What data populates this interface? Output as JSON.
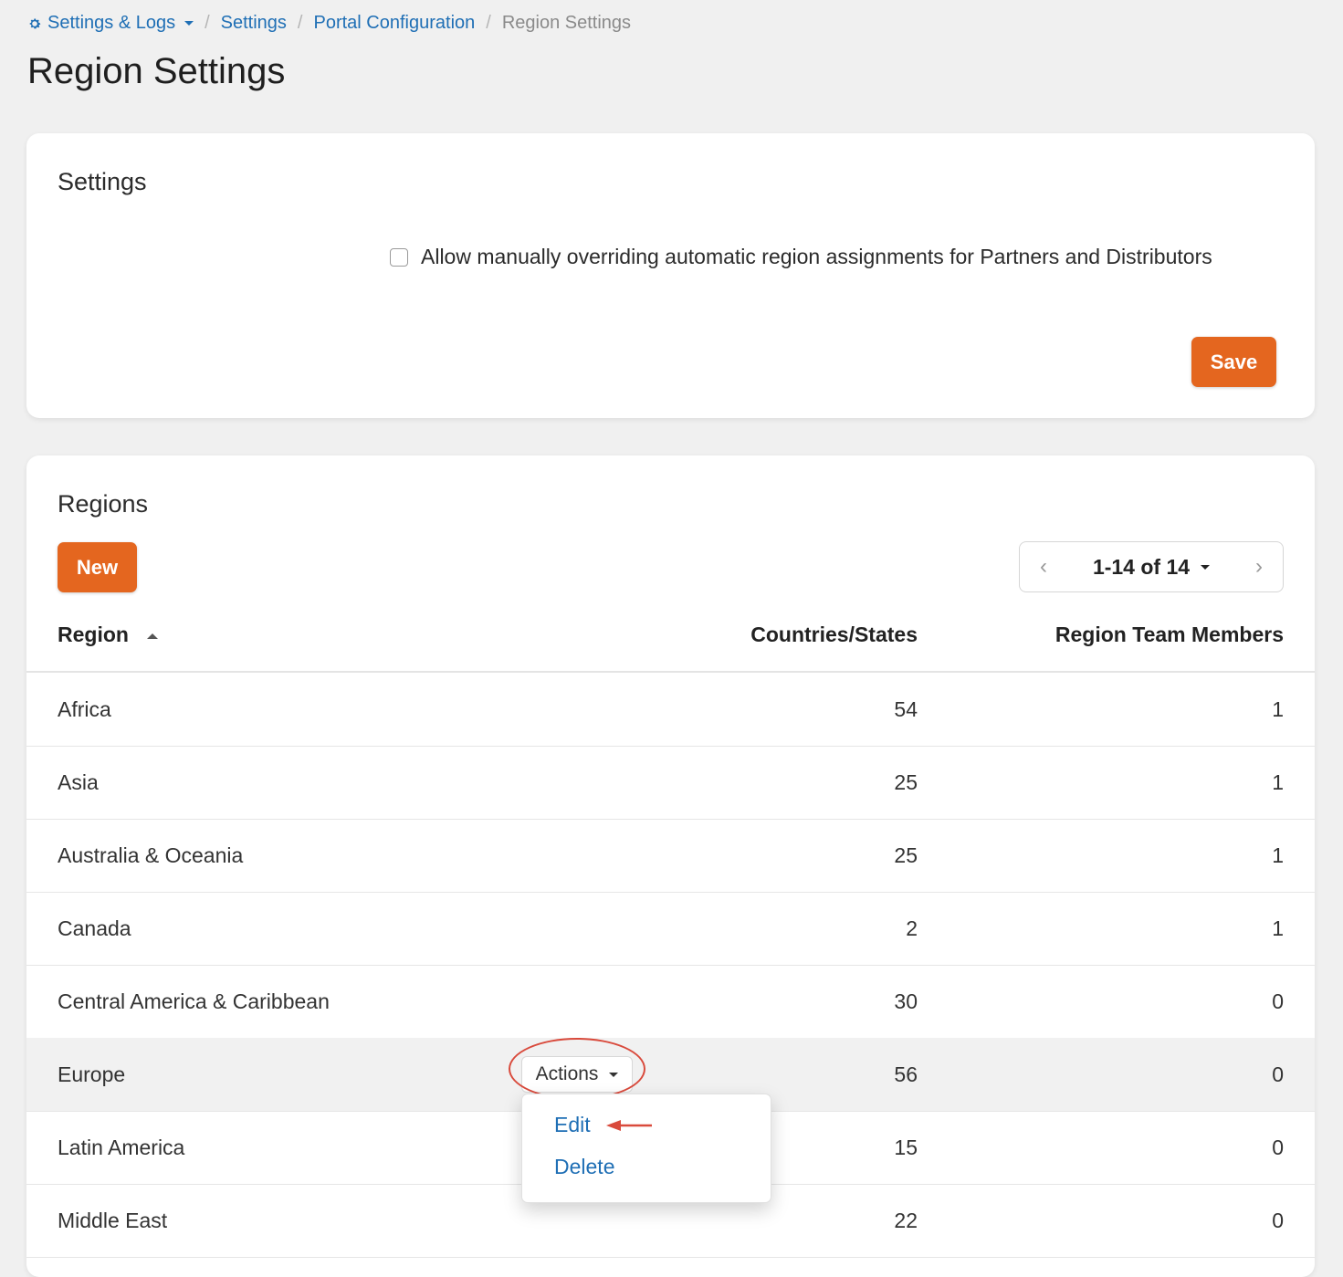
{
  "breadcrumb": {
    "root": "Settings & Logs",
    "item1": "Settings",
    "item2": "Portal Configuration",
    "current": "Region Settings"
  },
  "page_title": "Region Settings",
  "settings_card": {
    "title": "Settings",
    "checkbox_label": "Allow manually overriding automatic region assignments for Partners and Distributors",
    "checkbox_checked": false,
    "save_label": "Save"
  },
  "regions_card": {
    "title": "Regions",
    "new_label": "New",
    "pager_label": "1-14 of 14",
    "columns": {
      "region": "Region",
      "countries": "Countries/States",
      "members": "Region Team Members"
    },
    "rows": [
      {
        "region": "Africa",
        "countries": "54",
        "members": "1"
      },
      {
        "region": "Asia",
        "countries": "25",
        "members": "1"
      },
      {
        "region": "Australia & Oceania",
        "countries": "25",
        "members": "1"
      },
      {
        "region": "Canada",
        "countries": "2",
        "members": "1"
      },
      {
        "region": "Central America & Caribbean",
        "countries": "30",
        "members": "0"
      },
      {
        "region": "Europe",
        "countries": "56",
        "members": "0"
      },
      {
        "region": "Latin America",
        "countries": "15",
        "members": "0"
      },
      {
        "region": "Middle East",
        "countries": "22",
        "members": "0"
      }
    ],
    "actions_label": "Actions",
    "menu": {
      "edit": "Edit",
      "delete": "Delete"
    }
  },
  "colors": {
    "accent": "#e4661f",
    "link": "#1f6fb5",
    "annotation": "#d94a3c"
  },
  "icons": {
    "breadcrumb_root": "gear-icon",
    "sort": "sort-ascending-icon",
    "pager_prev": "chevron-left-icon",
    "pager_next": "chevron-right-icon"
  }
}
